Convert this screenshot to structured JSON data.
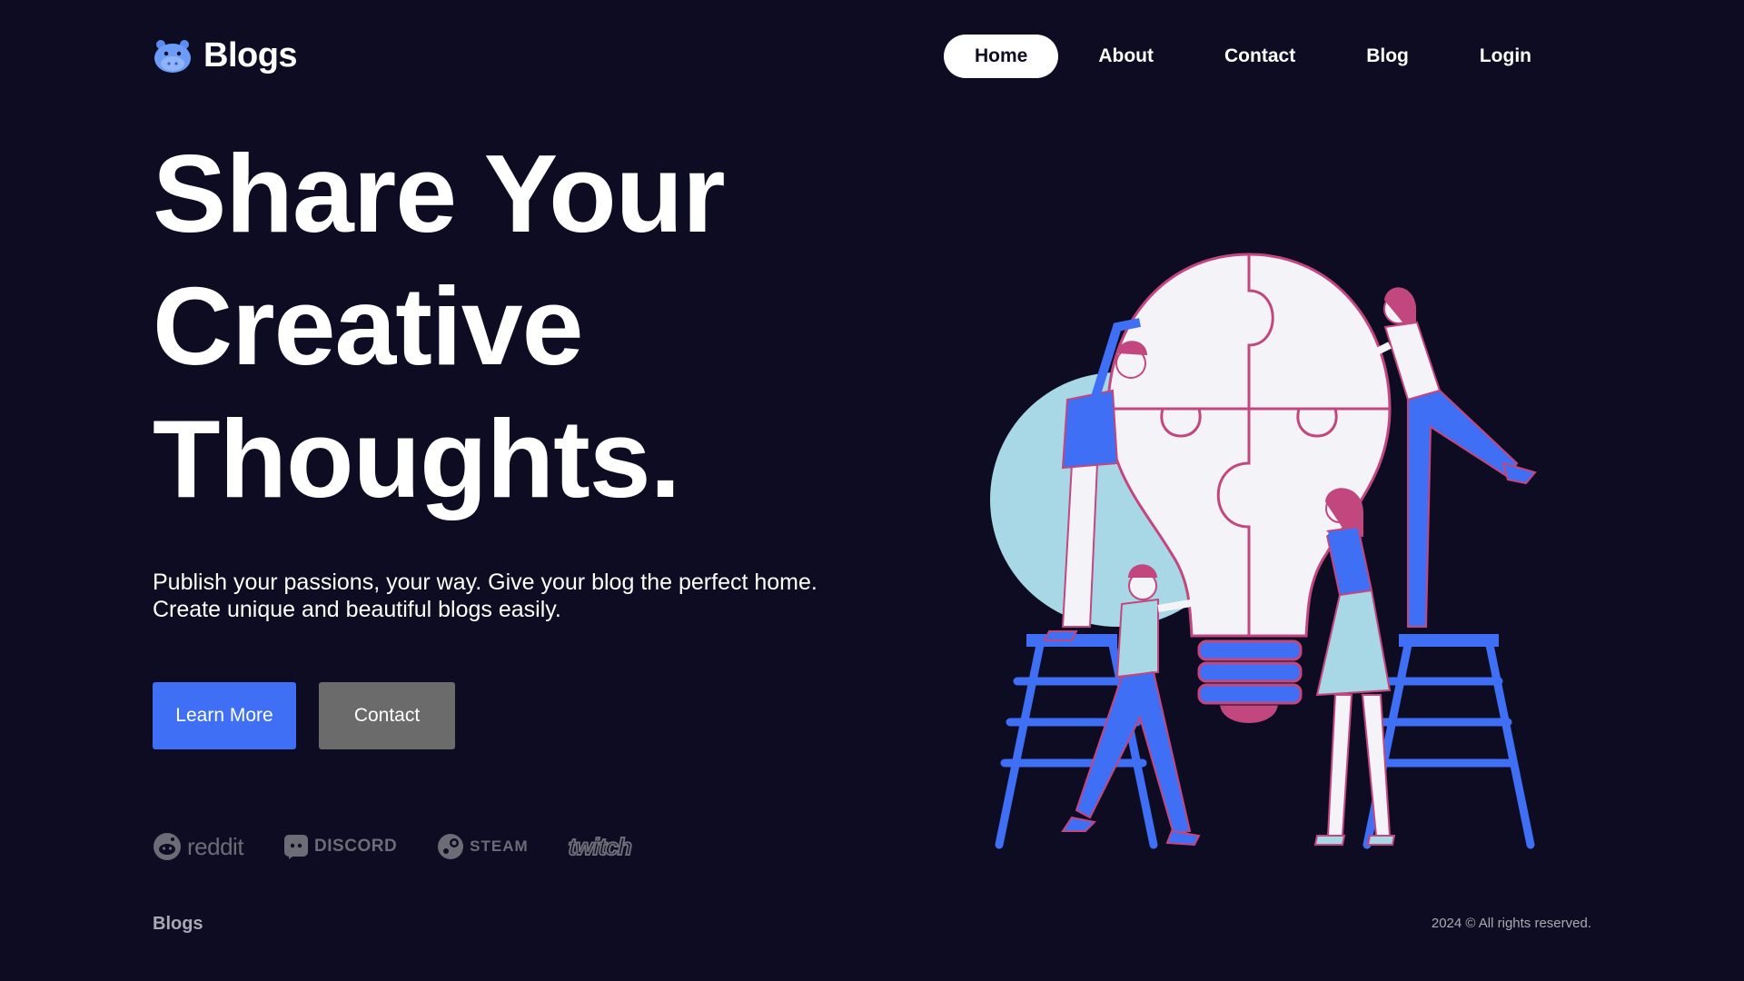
{
  "brand": {
    "name": "Blogs",
    "icon": "hippo-logo-icon"
  },
  "nav": {
    "items": [
      {
        "label": "Home",
        "active": true
      },
      {
        "label": "About",
        "active": false
      },
      {
        "label": "Contact",
        "active": false
      },
      {
        "label": "Blog",
        "active": false
      },
      {
        "label": "Login",
        "active": false
      }
    ]
  },
  "hero": {
    "title_lines": [
      "Share Your",
      "Creative",
      "Thoughts."
    ],
    "subtitle": "Publish your passions, your way. Give your blog the perfect home. Create unique and beautiful blogs easily.",
    "primary_button": "Learn More",
    "secondary_button": "Contact"
  },
  "brands": [
    {
      "name": "reddit",
      "icon": "reddit-icon"
    },
    {
      "name": "DISCORD",
      "icon": "discord-icon"
    },
    {
      "name": "STEAM",
      "icon": "steam-icon"
    },
    {
      "name": "twitch",
      "icon": "twitch-logo"
    }
  ],
  "footer": {
    "brand": "Blogs",
    "copyright": "2024 © All rights reserved."
  },
  "colors": {
    "background": "#0d0c22",
    "primary": "#3f6ff5",
    "secondary": "#6b6b6b",
    "illustration_blue": "#3f6ff5",
    "illustration_pink": "#c2477f",
    "illustration_teal": "#a8d8e6"
  }
}
